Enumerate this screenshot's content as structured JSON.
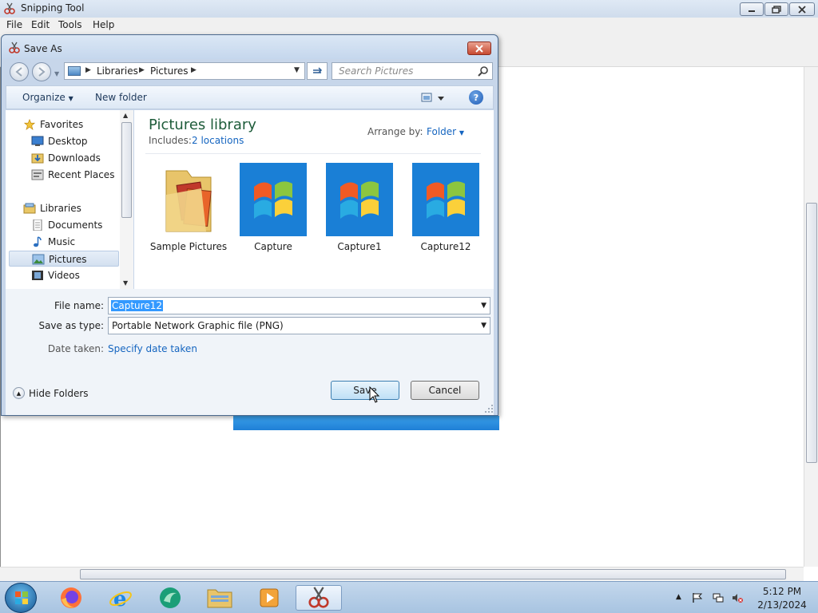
{
  "main_window": {
    "title": "Snipping Tool",
    "menu": [
      "File",
      "Edit",
      "Tools",
      "Help"
    ]
  },
  "dialog": {
    "title": "Save As",
    "breadcrumbs": [
      "Libraries",
      "Pictures"
    ],
    "search_placeholder": "Search Pictures",
    "organize_label": "Organize",
    "new_folder_label": "New folder",
    "nav_tree": [
      {
        "label": "Favorites",
        "icon": "star-icon"
      },
      {
        "label": "Desktop",
        "icon": "desktop-icon"
      },
      {
        "label": "Downloads",
        "icon": "downloads-icon"
      },
      {
        "label": "Recent Places",
        "icon": "recent-places-icon"
      },
      {
        "label": "Libraries",
        "icon": "libraries-icon"
      },
      {
        "label": "Documents",
        "icon": "documents-icon"
      },
      {
        "label": "Music",
        "icon": "music-icon"
      },
      {
        "label": "Pictures",
        "icon": "pictures-icon",
        "selected": true
      },
      {
        "label": "Videos",
        "icon": "videos-icon"
      }
    ],
    "library": {
      "title": "Pictures library",
      "includes_label": "Includes:",
      "locations_link": "2 locations",
      "arrange_label": "Arrange by:",
      "arrange_value": "Folder"
    },
    "files": [
      {
        "name": "Sample Pictures",
        "icon": "folder-icon"
      },
      {
        "name": "Capture",
        "icon": "image-thumbnail"
      },
      {
        "name": "Capture1",
        "icon": "image-thumbnail"
      },
      {
        "name": "Capture12",
        "icon": "image-thumbnail"
      }
    ],
    "form": {
      "filename_label": "File name:",
      "filename_value": "Capture12",
      "type_label": "Save as type:",
      "type_value": "Portable Network Graphic file (PNG)",
      "date_label": "Date taken:",
      "date_link": "Specify date taken"
    },
    "hide_folders_label": "Hide Folders",
    "save_label": "Save",
    "cancel_label": "Cancel"
  },
  "taskbar": {
    "time": "5:12 PM",
    "date": "2/13/2024"
  },
  "colors": {
    "accent": "#1565c0",
    "library_title": "#1e5c3a",
    "selection": "#3399ff"
  }
}
